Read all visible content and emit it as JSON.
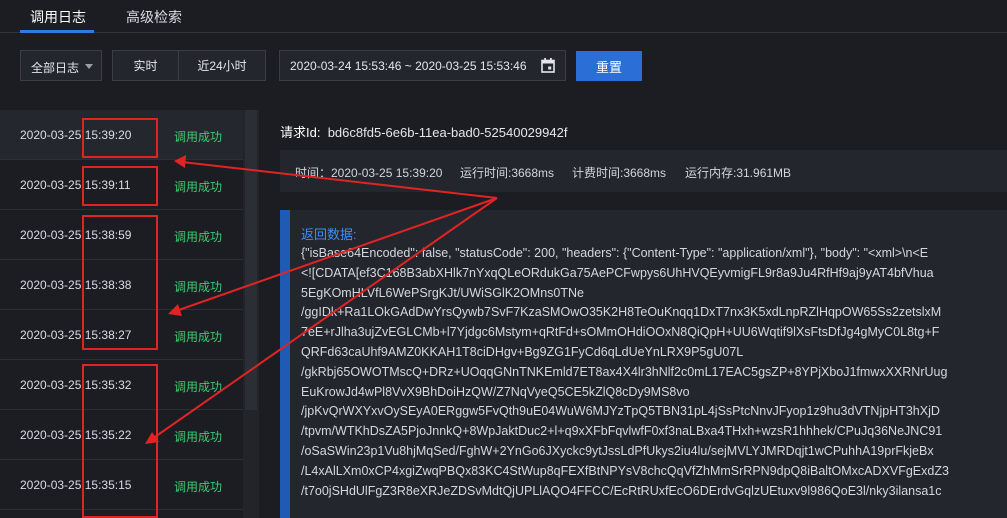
{
  "tabs": [
    {
      "label": "调用日志",
      "active": true
    },
    {
      "label": "高级检索",
      "active": false
    }
  ],
  "filters": {
    "log_type": "全部日志",
    "realtime_label": "实时",
    "last24h_label": "近24小时",
    "date_range": "2020-03-24 15:53:46 ~ 2020-03-25 15:53:46",
    "reset_label": "重置"
  },
  "log_list": [
    {
      "time": "2020-03-25 15:39:20",
      "status": "调用成功"
    },
    {
      "time": "2020-03-25 15:39:11",
      "status": "调用成功"
    },
    {
      "time": "2020-03-25 15:38:59",
      "status": "调用成功"
    },
    {
      "time": "2020-03-25 15:38:38",
      "status": "调用成功"
    },
    {
      "time": "2020-03-25 15:38:27",
      "status": "调用成功"
    },
    {
      "time": "2020-03-25 15:35:32",
      "status": "调用成功"
    },
    {
      "time": "2020-03-25 15:35:22",
      "status": "调用成功"
    },
    {
      "time": "2020-03-25 15:35:15",
      "status": "调用成功"
    }
  ],
  "detail": {
    "request_id_label": "请求Id:",
    "request_id": "bd6c8fd5-6e6b-11ea-bad0-52540029942f",
    "time": "时间：2020-03-25 15:39:20",
    "run_time": "运行时间:3668ms",
    "billing_time": "计费时间:3668ms",
    "memory": "运行内存:31.961MB",
    "return_title": "返回数据:",
    "return_lines": [
      "{\"isBase64Encoded\": false, \"statusCode\": 200, \"headers\": {\"Content-Type\": \"application/xml\"}, \"body\": \"<xml>\\n<E",
      "<![CDATA[ef3C168B3abXHlk7nYxqQLeORdukGa75AePCFwpys6UhHVQEyvmigFL9r8a9Ju4RfHf9aj9yAT4bfVhua",
      "5EgKOmHLVfL6WePSrgKJt/UWiSGlK2OMns0TNe",
      "/ggIDk+Ra1LOkGAdDwYrsQywb7SvF7KzaSMOwO35K2H8TeOuKnqq1DxT7nx3K5xdLnpRZlHqpOW65Ss2zetslxM",
      "7eE+rJlha3ujZvEGLCMb+l7Yjdgc6Mstym+qRtFd+sOMmOHdiOOxN8QiQpH+UU6Wqtif9lXsFtsDfJg4gMyC0L8tg+F",
      "QRFd63caUhf9AMZ0KKAH1T8ciDHgv+Bg9ZG1FyCd6qLdUeYnLRX9P5gU07L",
      "/gkRbj65OWOTMscQ+DRz+UOqqGNnTNKEmld7ET8ax4X4lr3hNlf2c0mL17EAC5gsZP+8YPjXboJ1fmwxXXRNrUug",
      "EuKrowJd4wPl8VvX9BhDoiHzQW/Z7NqVyeQ5CE5kZlQ8cDy9MS8vo",
      "/jpKvQrWXYxvOySEyA0ERggw5FvQth9uE04WuW6MJYzTpQ5TBN31pL4jSsPtcNnvJFyop1z9hu3dVTNjpHT3hXjD",
      "/tpvm/WTKhDsZA5PjoJnnkQ+8WpJaktDuc2+l+q9xXFbFqvlwfF0xf3naLBxa4THxh+wzsR1hhhek/CPuJq36NeJNC91",
      "/oSaSWin23p1Vu8hjMqSed/FghW+2YnGo6JXyckc9ytJssLdPfUkys2iu4lu/sejMVLYJMRDqjt1wCPuhhA19prFkjeBx",
      "/L4xAlLXm0xCP4xgiZwqPBQx83KC4StWup8qFEXfBtNPYsV8chcQqVfZhMmSrRPN9dpQ8iBaltOMxcADXVFgExdZ3",
      "/t7o0jSHdUlFgZ3R8eXRJeZDSvMdtQjUPLlAQO4FFCC/EcRtRUxfEcO6DErdvGqlzUEtuxv9l986QoE3l/nky3ilansa1c"
    ]
  }
}
